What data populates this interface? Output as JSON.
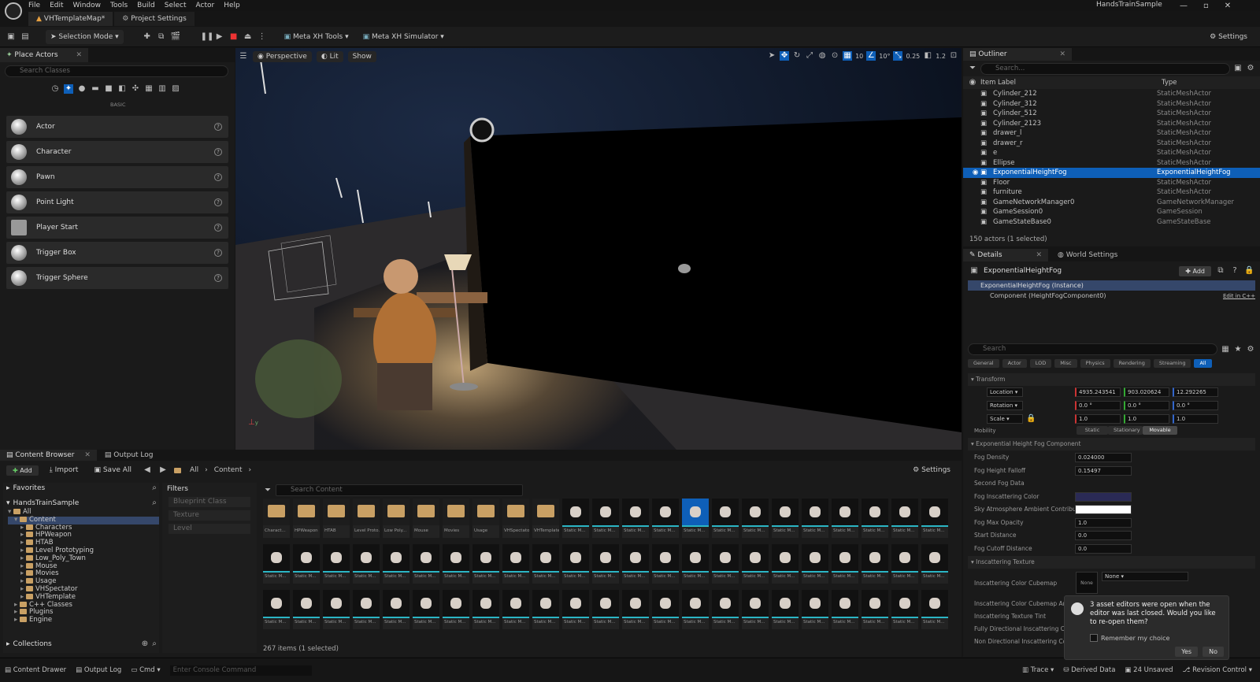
{
  "app": {
    "window_title": "HandsTrainSample",
    "menu": [
      "File",
      "Edit",
      "Window",
      "Tools",
      "Build",
      "Select",
      "Actor",
      "Help"
    ],
    "tabs": [
      {
        "label": "VHTemplateMap*"
      },
      {
        "label": "Project Settings"
      }
    ]
  },
  "toolbar": {
    "selection_mode": "Selection Mode",
    "metaxh_tools": "Meta XH Tools",
    "metaxh_sim": "Meta XH Simulator",
    "settings": "Settings"
  },
  "place_actors": {
    "tab": "Place Actors",
    "search_placeholder": "Search Classes",
    "category": "BASIC",
    "items": [
      "Actor",
      "Character",
      "Pawn",
      "Point Light",
      "Player Start",
      "Trigger Box",
      "Trigger Sphere"
    ]
  },
  "viewport": {
    "perspective": "Perspective",
    "lit": "Lit",
    "show": "Show",
    "grid": "10",
    "angle": "10°",
    "scale": "0.25",
    "cam_speed": "1.2"
  },
  "outliner": {
    "tab": "Outliner",
    "search_placeholder": "Search...",
    "col_label": "Item Label",
    "col_type": "Type",
    "rows": [
      {
        "label": "Cylinder_212",
        "type": "StaticMeshActor",
        "selected": false
      },
      {
        "label": "Cylinder_312",
        "type": "StaticMeshActor",
        "selected": false
      },
      {
        "label": "Cylinder_512",
        "type": "StaticMeshActor",
        "selected": false
      },
      {
        "label": "Cylinder_2123",
        "type": "StaticMeshActor",
        "selected": false
      },
      {
        "label": "drawer_l",
        "type": "StaticMeshActor",
        "selected": false
      },
      {
        "label": "drawer_r",
        "type": "StaticMeshActor",
        "selected": false
      },
      {
        "label": "e",
        "type": "StaticMeshActor",
        "selected": false
      },
      {
        "label": "Ellipse",
        "type": "StaticMeshActor",
        "selected": false
      },
      {
        "label": "ExponentialHeightFog",
        "type": "ExponentialHeightFog",
        "selected": true
      },
      {
        "label": "Floor",
        "type": "StaticMeshActor",
        "selected": false
      },
      {
        "label": "furniture",
        "type": "StaticMeshActor",
        "selected": false
      },
      {
        "label": "GameNetworkManager0",
        "type": "GameNetworkManager",
        "selected": false
      },
      {
        "label": "GameSession0",
        "type": "GameSession",
        "selected": false
      },
      {
        "label": "GameStateBase0",
        "type": "GameStateBase",
        "selected": false
      }
    ],
    "count": "150 actors (1 selected)"
  },
  "details": {
    "tab": "Details",
    "tab2": "World Settings",
    "object": "ExponentialHeightFog",
    "add": "Add",
    "instance": "ExponentialHeightFog (Instance)",
    "component": "Component (HeightFogComponent0)",
    "edit_cpp": "Edit in C++",
    "search_placeholder": "Search",
    "categories": [
      "General",
      "Actor",
      "LOD",
      "Misc",
      "Physics",
      "Rendering",
      "Streaming",
      "All"
    ],
    "transform": "Transform",
    "location": {
      "label": "Location",
      "x": "4935.243541",
      "y": "903.020624",
      "z": "12.292265"
    },
    "rotation": {
      "label": "Rotation",
      "x": "0.0 °",
      "y": "0.0 °",
      "z": "0.0 °"
    },
    "scale": {
      "label": "Scale",
      "x": "1.0",
      "y": "1.0",
      "z": "1.0"
    },
    "mobility": {
      "label": "Mobility",
      "options": [
        "Static",
        "Stationary",
        "Movable"
      ]
    },
    "section_fog": "Exponential Height Fog Component",
    "props": [
      {
        "label": "Fog Density",
        "value": "0.024000"
      },
      {
        "label": "Fog Height Falloff",
        "value": "0.15497"
      },
      {
        "label": "Second Fog Data",
        "value": ""
      },
      {
        "label": "Fog Inscattering Color",
        "value": ""
      },
      {
        "label": "Sky Atmosphere Ambient Contribution...",
        "value": ""
      },
      {
        "label": "Fog Max Opacity",
        "value": "1.0"
      },
      {
        "label": "Start Distance",
        "value": "0.0"
      },
      {
        "label": "Fog Cutoff Distance",
        "value": "0.0"
      }
    ],
    "section_tex": "Inscattering Texture",
    "tex_props": [
      "Inscattering Color Cubemap",
      "Inscattering Color Cubemap Angle",
      "Inscattering Texture Tint",
      "Fully Directional Inscattering Color Dist...",
      "Non Directional Inscattering Color Dist..."
    ],
    "none": "None"
  },
  "content_browser": {
    "tab": "Content Browser",
    "tab2": "Output Log",
    "add": "Add",
    "import": "Import",
    "save_all": "Save All",
    "path": [
      "All",
      "Content"
    ],
    "settings": "Settings",
    "favorites": "Favorites",
    "project": "HandsTrainSample",
    "filters": "Filters",
    "filter_items": [
      "Blueprint Class",
      "Texture",
      "Level"
    ],
    "search_placeholder": "Search Content",
    "tree": [
      "All",
      "Content",
      "Characters",
      "HPWeapon",
      "HTAB",
      "Level Prototyping",
      "Low_Poly_Town",
      "Mouse",
      "Movies",
      "Usage",
      "VHSpectator",
      "VHTemplate",
      "C++ Classes",
      "Plugins",
      "Engine"
    ],
    "collections": "Collections",
    "item_count": "267 items (1 selected)",
    "folders": [
      "Charact...",
      "HPWeapon",
      "HTAB",
      "Level Proto...",
      "Low Poly...",
      "Mouse",
      "Movies",
      "Usage",
      "VHSpectator",
      "VHTemplate"
    ],
    "asset_label": "Static M..."
  },
  "statusbar": {
    "drawer": "Content Drawer",
    "output": "Output Log",
    "cmd": "Cmd",
    "console_placeholder": "Enter Console Command",
    "trace": "Trace",
    "derived": "Derived Data",
    "unsaved": "24 Unsaved",
    "revision": "Revision Control"
  },
  "toast": {
    "message": "3 asset editors were open when the editor was last closed. Would you like to re-open them?",
    "remember": "Remember my choice",
    "yes": "Yes",
    "no": "No"
  },
  "colors": {
    "accent": "#0e5fb8",
    "folder": "#c9a064"
  }
}
